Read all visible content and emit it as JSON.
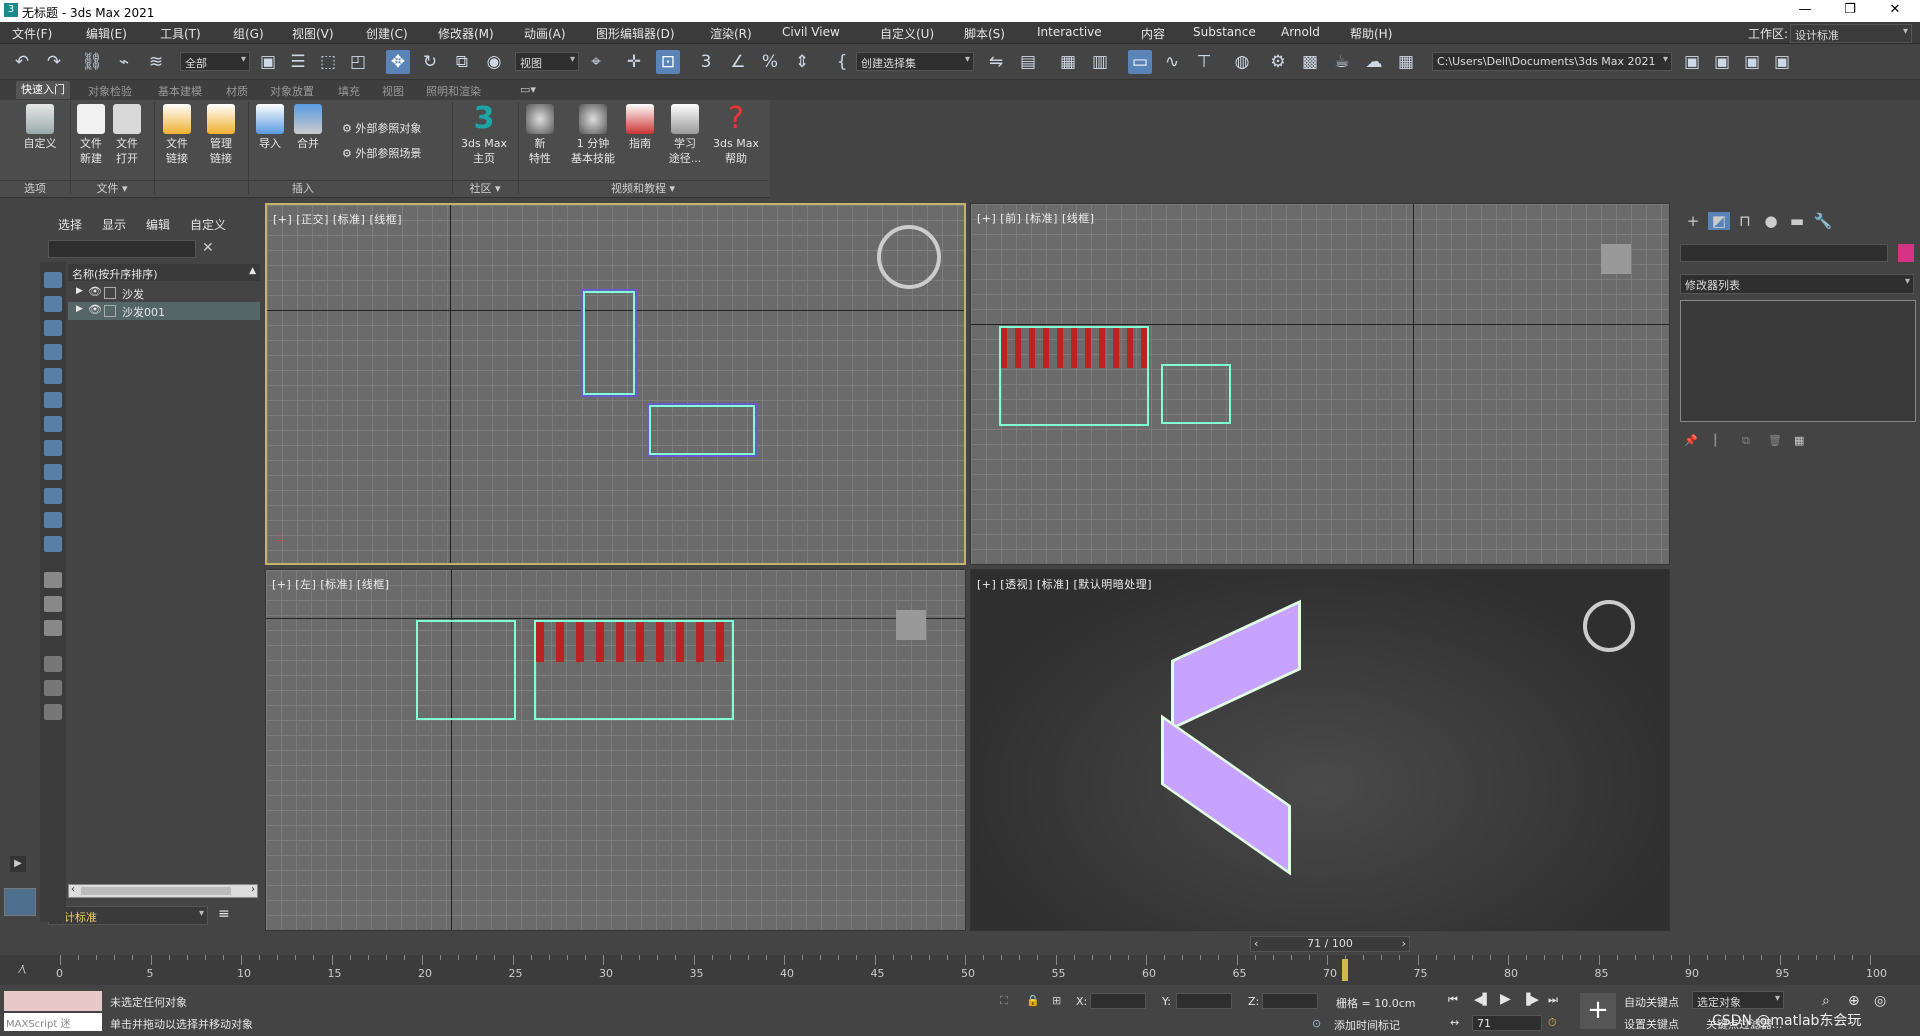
{
  "window": {
    "title": "无标题 - 3ds Max 2021",
    "icon": "3",
    "controls": [
      "—",
      "❐",
      "✕"
    ]
  },
  "menu": [
    "文件(F)",
    "编辑(E)",
    "工具(T)",
    "组(G)",
    "视图(V)",
    "创建(C)",
    "修改器(M)",
    "动画(A)",
    "图形编辑器(D)",
    "渲染(R)",
    "Civil View",
    "自定义(U)",
    "脚本(S)",
    "Interactive",
    "内容",
    "Substance",
    "Arnold",
    "帮助(H)"
  ],
  "workspace": {
    "label": "工作区:",
    "value": "设计标准"
  },
  "toolbar": {
    "filter": "全部",
    "refcoord": "视图",
    "selset": "创建选择集",
    "project_path": "C:\\Users\\Dell\\Documents\\3ds Max 2021"
  },
  "ribbon_tabs": [
    "快速入门",
    "对象检验",
    "基本建模",
    "材质",
    "对象放置",
    "填充",
    "视图",
    "照明和渲染"
  ],
  "ribbon": {
    "buttons": [
      {
        "label": "自定义",
        "icon": "customize-icon"
      },
      {
        "label": "文件\n新建",
        "icon": "new-file-icon"
      },
      {
        "label": "文件\n打开",
        "icon": "open-file-icon"
      },
      {
        "label": "文件\n链接",
        "icon": "file-link-icon"
      },
      {
        "label": "管理\n链接",
        "icon": "manage-links-icon"
      },
      {
        "label": "导入",
        "icon": "import-icon"
      },
      {
        "label": "合并",
        "icon": "merge-icon"
      },
      {
        "label": "3ds Max\n主页",
        "icon": "max-home-icon"
      },
      {
        "label": "新\n特性",
        "icon": "new-features-icon"
      },
      {
        "label": "1 分钟\n基本技能",
        "icon": "one-minute-icon"
      },
      {
        "label": "指南",
        "icon": "guide-icon"
      },
      {
        "label": "学习\n途径...",
        "icon": "learn-icon"
      },
      {
        "label": "3ds Max\n帮助",
        "icon": "help-icon"
      }
    ],
    "xref_obj": "外部参照对象",
    "xref_scene": "外部参照场景",
    "groups": [
      "选项",
      "文件 ▾",
      "插入",
      "社区 ▾",
      "视频和教程 ▾"
    ]
  },
  "scene_explorer": {
    "tabs": [
      "选择",
      "显示",
      "编辑",
      "自定义"
    ],
    "header": "名称(按升序排序)",
    "items": [
      "沙发",
      "沙发001"
    ]
  },
  "viewports": {
    "top": "[+] [正交] [标准] [线框]",
    "front": "[+] [前] [标准] [线框]",
    "left": "[+] [左] [标准] [线框]",
    "persp": "[+] [透视] [标准] [默认明暗处理]"
  },
  "command_panel": {
    "modifier_list": "修改器列表"
  },
  "left_bottom": {
    "workspace": "设计标准"
  },
  "timeline": {
    "frame": "71 / 100",
    "current": 71,
    "max": 100,
    "ticks": [
      "0",
      "5",
      "10",
      "15",
      "20",
      "25",
      "30",
      "35",
      "40",
      "45",
      "50",
      "55",
      "60",
      "65",
      "70",
      "75",
      "80",
      "85",
      "90",
      "95",
      "100"
    ]
  },
  "status": {
    "maxscript": "MAXScript 迷",
    "none_selected": "未选定任何对象",
    "hint": "单击并拖动以选择并移动对象",
    "x": "X:",
    "y": "Y:",
    "z": "Z:",
    "grid": "栅格 = 10.0cm",
    "add_time_tag": "添加时间标记",
    "auto_key": "自动关键点",
    "set_key": "设置关键点",
    "selected_obj": "选定对象",
    "key_filters": "关键点过滤器...",
    "frame_field": "71",
    "watermark": "CSDN @matlab东会玩"
  },
  "colors": {
    "accent": "#5a84b8",
    "bg": "#444444",
    "viewport": "#6b6b6b",
    "active_border": "#c8b26a"
  }
}
